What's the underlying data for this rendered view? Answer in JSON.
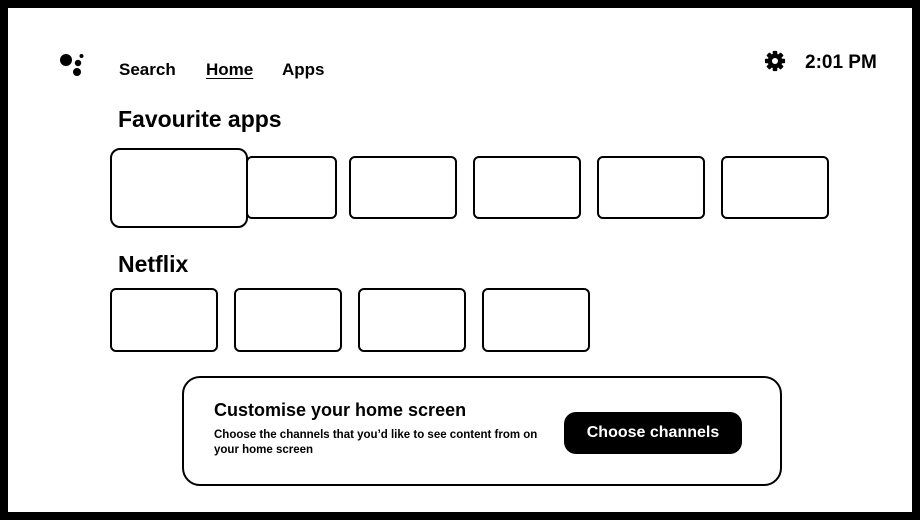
{
  "nav": {
    "items": [
      {
        "label": "Search"
      },
      {
        "label": "Home",
        "selected": true
      },
      {
        "label": "Apps"
      }
    ]
  },
  "status": {
    "time": "2:01 PM",
    "settings_icon": "gear-icon",
    "assistant_icon": "google-assistant-icon"
  },
  "sections": {
    "favourites": {
      "title": "Favourite apps",
      "tile_count": 6,
      "focused_index": 0
    },
    "netflix": {
      "title": "Netflix",
      "tile_count": 4
    }
  },
  "customise_card": {
    "title": "Customise your home screen",
    "body": "Choose the channels that you’d like to see content from on your home screen",
    "button_label": "Choose channels"
  }
}
